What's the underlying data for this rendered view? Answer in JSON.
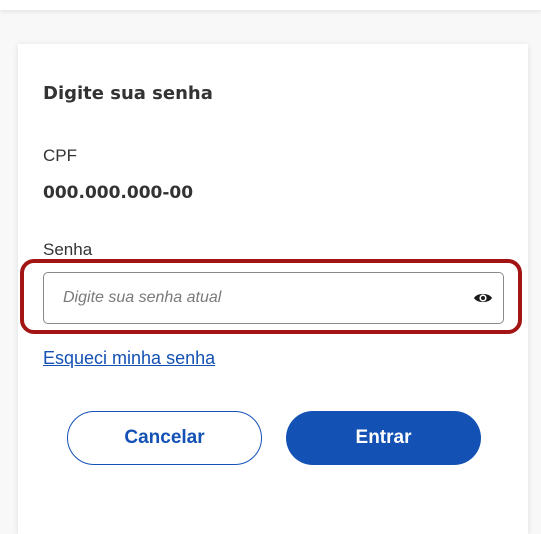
{
  "form": {
    "title": "Digite sua senha",
    "cpf_label": "CPF",
    "cpf_value": "000.000.000-00",
    "password_label": "Senha",
    "password_placeholder": "Digite sua senha atual",
    "password_value": "",
    "forgot_link": "Esqueci minha senha"
  },
  "actions": {
    "cancel_label": "Cancelar",
    "enter_label": "Entrar"
  },
  "icons": {
    "visibility_toggle": "eye-icon"
  },
  "colors": {
    "primary": "#1351b4",
    "highlight": "#a31515",
    "text": "#333333"
  }
}
